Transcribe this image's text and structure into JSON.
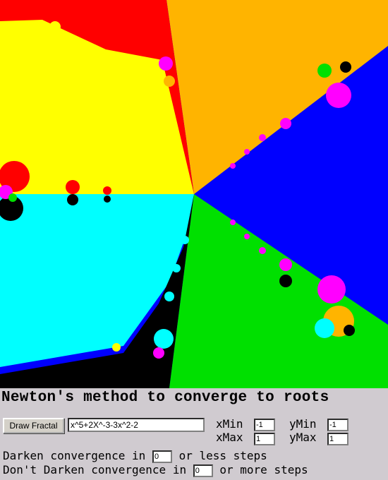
{
  "fractal": {
    "expression_roots_colors": [
      "#ff0000",
      "#ffb400",
      "#0000ff",
      "#00e000",
      "#000000",
      "#00ffff",
      "#ffff00"
    ],
    "accent_colors": {
      "red": "#ff0000",
      "orange": "#ffb400",
      "blue": "#0000ff",
      "green": "#00e000",
      "black": "#000000",
      "cyan": "#00ffff",
      "yellow": "#ffff00",
      "magenta": "#ff00ff"
    }
  },
  "title": "Newton's method to converge to roots",
  "controls": {
    "draw_button_label": "Draw Fractal",
    "expression_value": "x^5+2X^-3-3x^2-2",
    "xmin_label": "xMin",
    "xmin_value": "-1",
    "ymin_label": "yMin",
    "ymin_value": "-1",
    "xmax_label": "xMax",
    "xmax_value": "1",
    "ymax_label": "yMax",
    "ymax_value": "1"
  },
  "darken": {
    "prefix": "Darken convergence in",
    "value": "0",
    "suffix": "or less steps"
  },
  "no_darken": {
    "prefix": "Don't Darken convergence in",
    "value": "0",
    "suffix": "or more steps"
  }
}
